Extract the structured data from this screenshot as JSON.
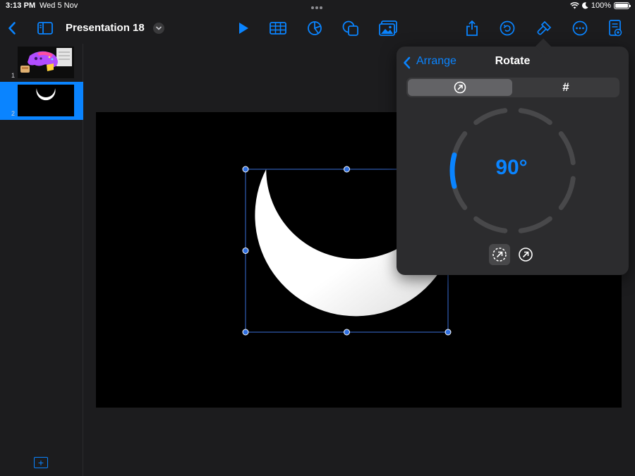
{
  "status_bar": {
    "time": "3:13 PM",
    "date": "Wed 5 Nov",
    "battery": "100%",
    "icons": [
      "wifi-icon",
      "moon-icon",
      "battery-icon"
    ]
  },
  "toolbar": {
    "title": "Presentation 18",
    "left_icons": [
      "back-chevron-icon",
      "sidebar-toggle-icon",
      "title-menu-chevron-icon"
    ],
    "center_icons": [
      "play-icon",
      "table-icon",
      "chart-icon",
      "shape-icon",
      "media-icon"
    ],
    "right_icons": [
      "share-icon",
      "undo-icon",
      "format-brush-icon",
      "more-icon",
      "presenter-notes-icon"
    ]
  },
  "slides": [
    {
      "number": "1",
      "selected": false,
      "content": "game-controller-artwork"
    },
    {
      "number": "2",
      "selected": true,
      "content": "crescent-moon"
    }
  ],
  "sidebar": {
    "add_slide_icon": "add-slide-icon"
  },
  "rotate_popover": {
    "back_label": "Arrange",
    "title": "Rotate",
    "segments": [
      {
        "icon": "rotate-dial-icon",
        "selected": true
      },
      {
        "label": "#",
        "selected": false
      }
    ],
    "angle_value": "90°",
    "angle_degrees": 90,
    "flip_buttons": [
      {
        "icon": "rotate-free-icon",
        "selected": true
      },
      {
        "icon": "rotate-arrow-icon",
        "selected": false
      }
    ]
  },
  "colors": {
    "accent": "#0a84ff",
    "background": "#1c1c1e",
    "panel": "#2c2c2e",
    "canvas": "#000000",
    "shape": "#ffffff"
  }
}
